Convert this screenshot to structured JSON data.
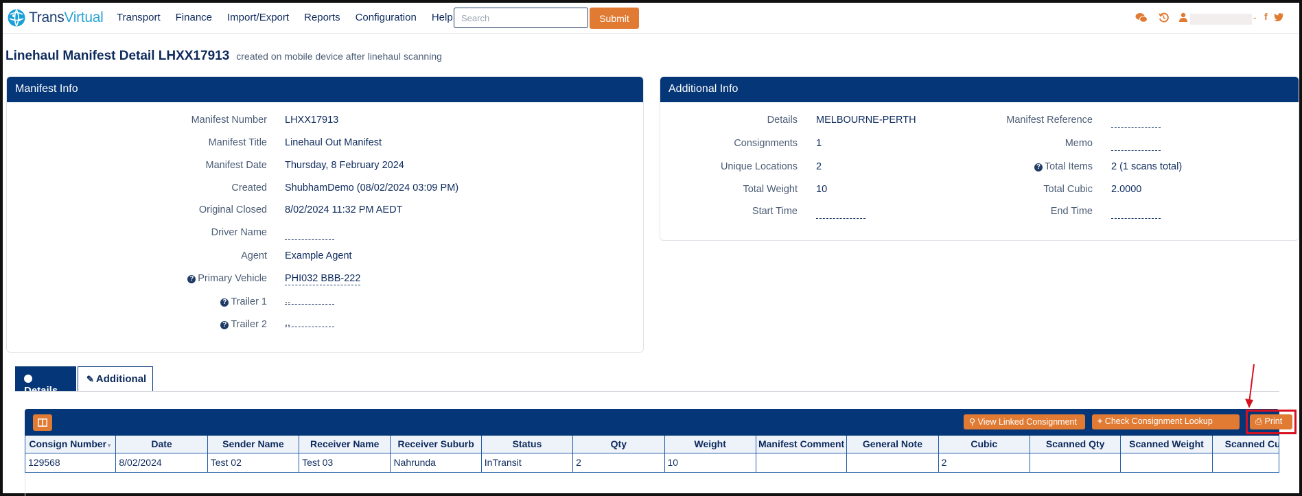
{
  "app": {
    "logo_text_a": "Trans",
    "logo_text_b": "Virtual"
  },
  "nav": {
    "menu": [
      "Transport",
      "Finance",
      "Import/Export",
      "Reports",
      "Configuration",
      "Help"
    ],
    "search_placeholder": "Search",
    "submit_label": "Submit",
    "icons": [
      "chat-icon",
      "history-icon",
      "user-icon",
      "facebook-icon",
      "twitter-icon"
    ],
    "dash": "-",
    "facebook": "f"
  },
  "page": {
    "title": "Linehaul Manifest Detail LHXX17913",
    "subtitle": "created on mobile device after linehaul scanning"
  },
  "manifest_info": {
    "heading": "Manifest Info",
    "rows": [
      {
        "label": "Manifest Number",
        "value": "LHXX17913"
      },
      {
        "label": "Manifest Title",
        "value": "Linehaul Out Manifest"
      },
      {
        "label": "Manifest Date",
        "value": "Thursday, 8 February 2024"
      },
      {
        "label": "Created",
        "value": "ShubhamDemo (08/02/2024 03:09 PM)"
      },
      {
        "label": "Original Closed",
        "value": "8/02/2024 11:32 PM AEDT"
      },
      {
        "label": "Driver Name",
        "value": ""
      },
      {
        "label": "Agent",
        "value": "Example Agent"
      },
      {
        "label": "Primary Vehicle",
        "value": "PHI032 BBB-222"
      },
      {
        "label": "Trailer 1",
        "value": ".."
      },
      {
        "label": "Trailer 2",
        "value": ".."
      }
    ]
  },
  "additional_info": {
    "heading": "Additional Info",
    "left": [
      {
        "label": "Details",
        "value": "MELBOURNE-PERTH"
      },
      {
        "label": "Consignments",
        "value": "1"
      },
      {
        "label": "Unique Locations",
        "value": "2"
      },
      {
        "label": "Total Weight",
        "value": "10"
      },
      {
        "label": "Start Time",
        "value": ""
      }
    ],
    "right": [
      {
        "label": "Manifest Reference",
        "value": ""
      },
      {
        "label": "Memo",
        "value": ""
      },
      {
        "label": "Total Items",
        "value": "2 (1 scans total)"
      },
      {
        "label": "Total Cubic",
        "value": "2.0000"
      },
      {
        "label": "End Time",
        "value": ""
      }
    ]
  },
  "tabs": [
    {
      "label": "Details",
      "active": true
    },
    {
      "label": "Additional",
      "active": false
    }
  ],
  "grid": {
    "buttons": {
      "view_linked": "View Linked Consignment",
      "check_lookup": "Check Consignment Lookup",
      "print": "Print"
    },
    "columns": [
      "Consign Number",
      "Date",
      "Sender Name",
      "Receiver Name",
      "Receiver Suburb",
      "Status",
      "Qty",
      "Weight",
      "Manifest Comment",
      "General Note",
      "Cubic",
      "Scanned Qty",
      "Scanned Weight",
      "Scanned Cubic"
    ],
    "rows": [
      [
        "129568",
        "8/02/2024",
        "Test 02",
        "Test 03",
        "Nahrunda",
        "InTransit",
        "2",
        "10",
        "",
        "",
        "2",
        "",
        "",
        ""
      ]
    ]
  },
  "colors": {
    "navy": "#053677",
    "orange": "#e17b33",
    "highlight": "#d7101f"
  }
}
